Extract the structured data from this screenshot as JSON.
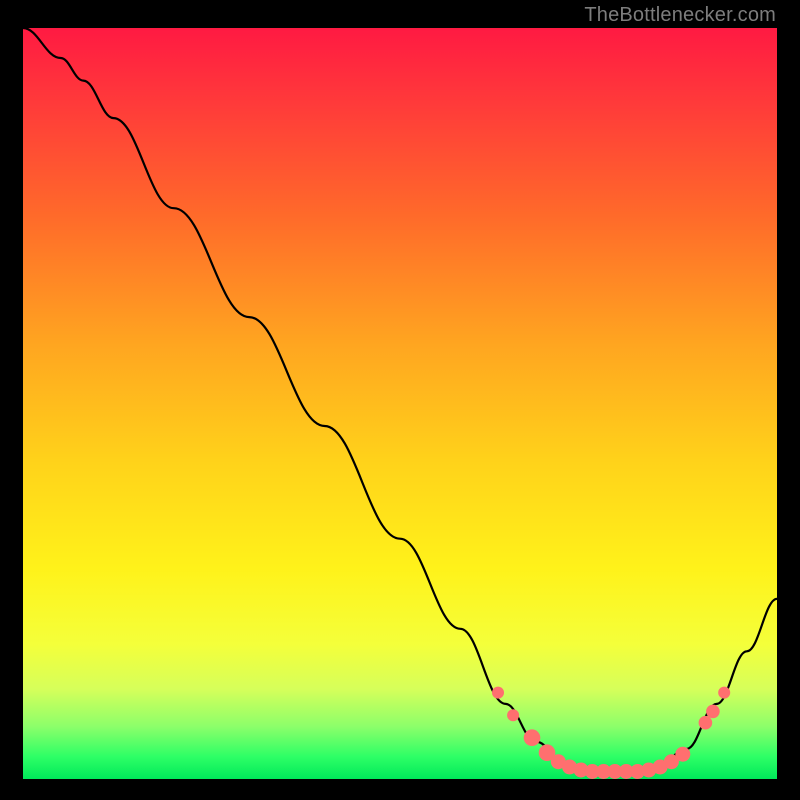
{
  "attribution": "TheBottlenecker.com",
  "colors": {
    "gradient_top": "#ff1a42",
    "gradient_bottom": "#00e85a",
    "curve": "#000000",
    "marker": "#ff6f6f",
    "page_bg": "#000000"
  },
  "chart_data": {
    "type": "line",
    "title": "",
    "xlabel": "",
    "ylabel": "",
    "xlim": [
      0,
      100
    ],
    "ylim": [
      0,
      100
    ],
    "note": "No axis ticks or labels are shown. Positions below are read in % of the plot area (x left→right, y bottom→top).",
    "curve_points": [
      {
        "x": 0.0,
        "y": 100.0
      },
      {
        "x": 5.0,
        "y": 96.0
      },
      {
        "x": 8.0,
        "y": 93.0
      },
      {
        "x": 12.0,
        "y": 88.0
      },
      {
        "x": 20.0,
        "y": 76.0
      },
      {
        "x": 30.0,
        "y": 61.5
      },
      {
        "x": 40.0,
        "y": 47.0
      },
      {
        "x": 50.0,
        "y": 32.0
      },
      {
        "x": 58.0,
        "y": 20.0
      },
      {
        "x": 64.0,
        "y": 10.0
      },
      {
        "x": 68.0,
        "y": 5.0
      },
      {
        "x": 72.0,
        "y": 2.0
      },
      {
        "x": 76.0,
        "y": 1.0
      },
      {
        "x": 80.0,
        "y": 1.0
      },
      {
        "x": 84.0,
        "y": 1.5
      },
      {
        "x": 88.0,
        "y": 4.0
      },
      {
        "x": 92.0,
        "y": 10.0
      },
      {
        "x": 96.0,
        "y": 17.0
      },
      {
        "x": 100.0,
        "y": 24.0
      }
    ],
    "markers": [
      {
        "x": 63.0,
        "y": 11.5,
        "r": 0.8
      },
      {
        "x": 65.0,
        "y": 8.5,
        "r": 0.8
      },
      {
        "x": 67.5,
        "y": 5.5,
        "r": 1.1
      },
      {
        "x": 69.5,
        "y": 3.5,
        "r": 1.1
      },
      {
        "x": 71.0,
        "y": 2.3,
        "r": 1.0
      },
      {
        "x": 72.5,
        "y": 1.6,
        "r": 1.0
      },
      {
        "x": 74.0,
        "y": 1.2,
        "r": 1.0
      },
      {
        "x": 75.5,
        "y": 1.0,
        "r": 1.0
      },
      {
        "x": 77.0,
        "y": 1.0,
        "r": 1.0
      },
      {
        "x": 78.5,
        "y": 1.0,
        "r": 1.0
      },
      {
        "x": 80.0,
        "y": 1.0,
        "r": 1.0
      },
      {
        "x": 81.5,
        "y": 1.0,
        "r": 1.0
      },
      {
        "x": 83.0,
        "y": 1.2,
        "r": 1.0
      },
      {
        "x": 84.5,
        "y": 1.6,
        "r": 1.0
      },
      {
        "x": 86.0,
        "y": 2.3,
        "r": 1.0
      },
      {
        "x": 87.5,
        "y": 3.3,
        "r": 1.0
      },
      {
        "x": 90.5,
        "y": 7.5,
        "r": 0.9
      },
      {
        "x": 91.5,
        "y": 9.0,
        "r": 0.9
      },
      {
        "x": 93.0,
        "y": 11.5,
        "r": 0.8
      }
    ]
  }
}
